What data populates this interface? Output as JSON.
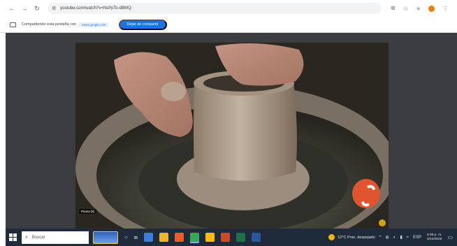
{
  "browser": {
    "url": "youtube.com/watch?v=NsPpTo-dBMQ"
  },
  "sharebar": {
    "text": "Compartiendo esta pestaña con",
    "chip": "meet.google.com",
    "stop_label": "Dejar de compartir"
  },
  "video": {
    "caption": "Pausa (k)"
  },
  "taskbar": {
    "search_placeholder": "Buscar",
    "weather": "12°C Prac. despejado",
    "language": "ESP",
    "time": "6:58 p. m.",
    "date": "6/10/2025"
  },
  "colors": {
    "accent": "#1a73e8",
    "profile": "#f57c00",
    "taskbar": "#1f2a3a",
    "video_logo": "#e2542d"
  }
}
